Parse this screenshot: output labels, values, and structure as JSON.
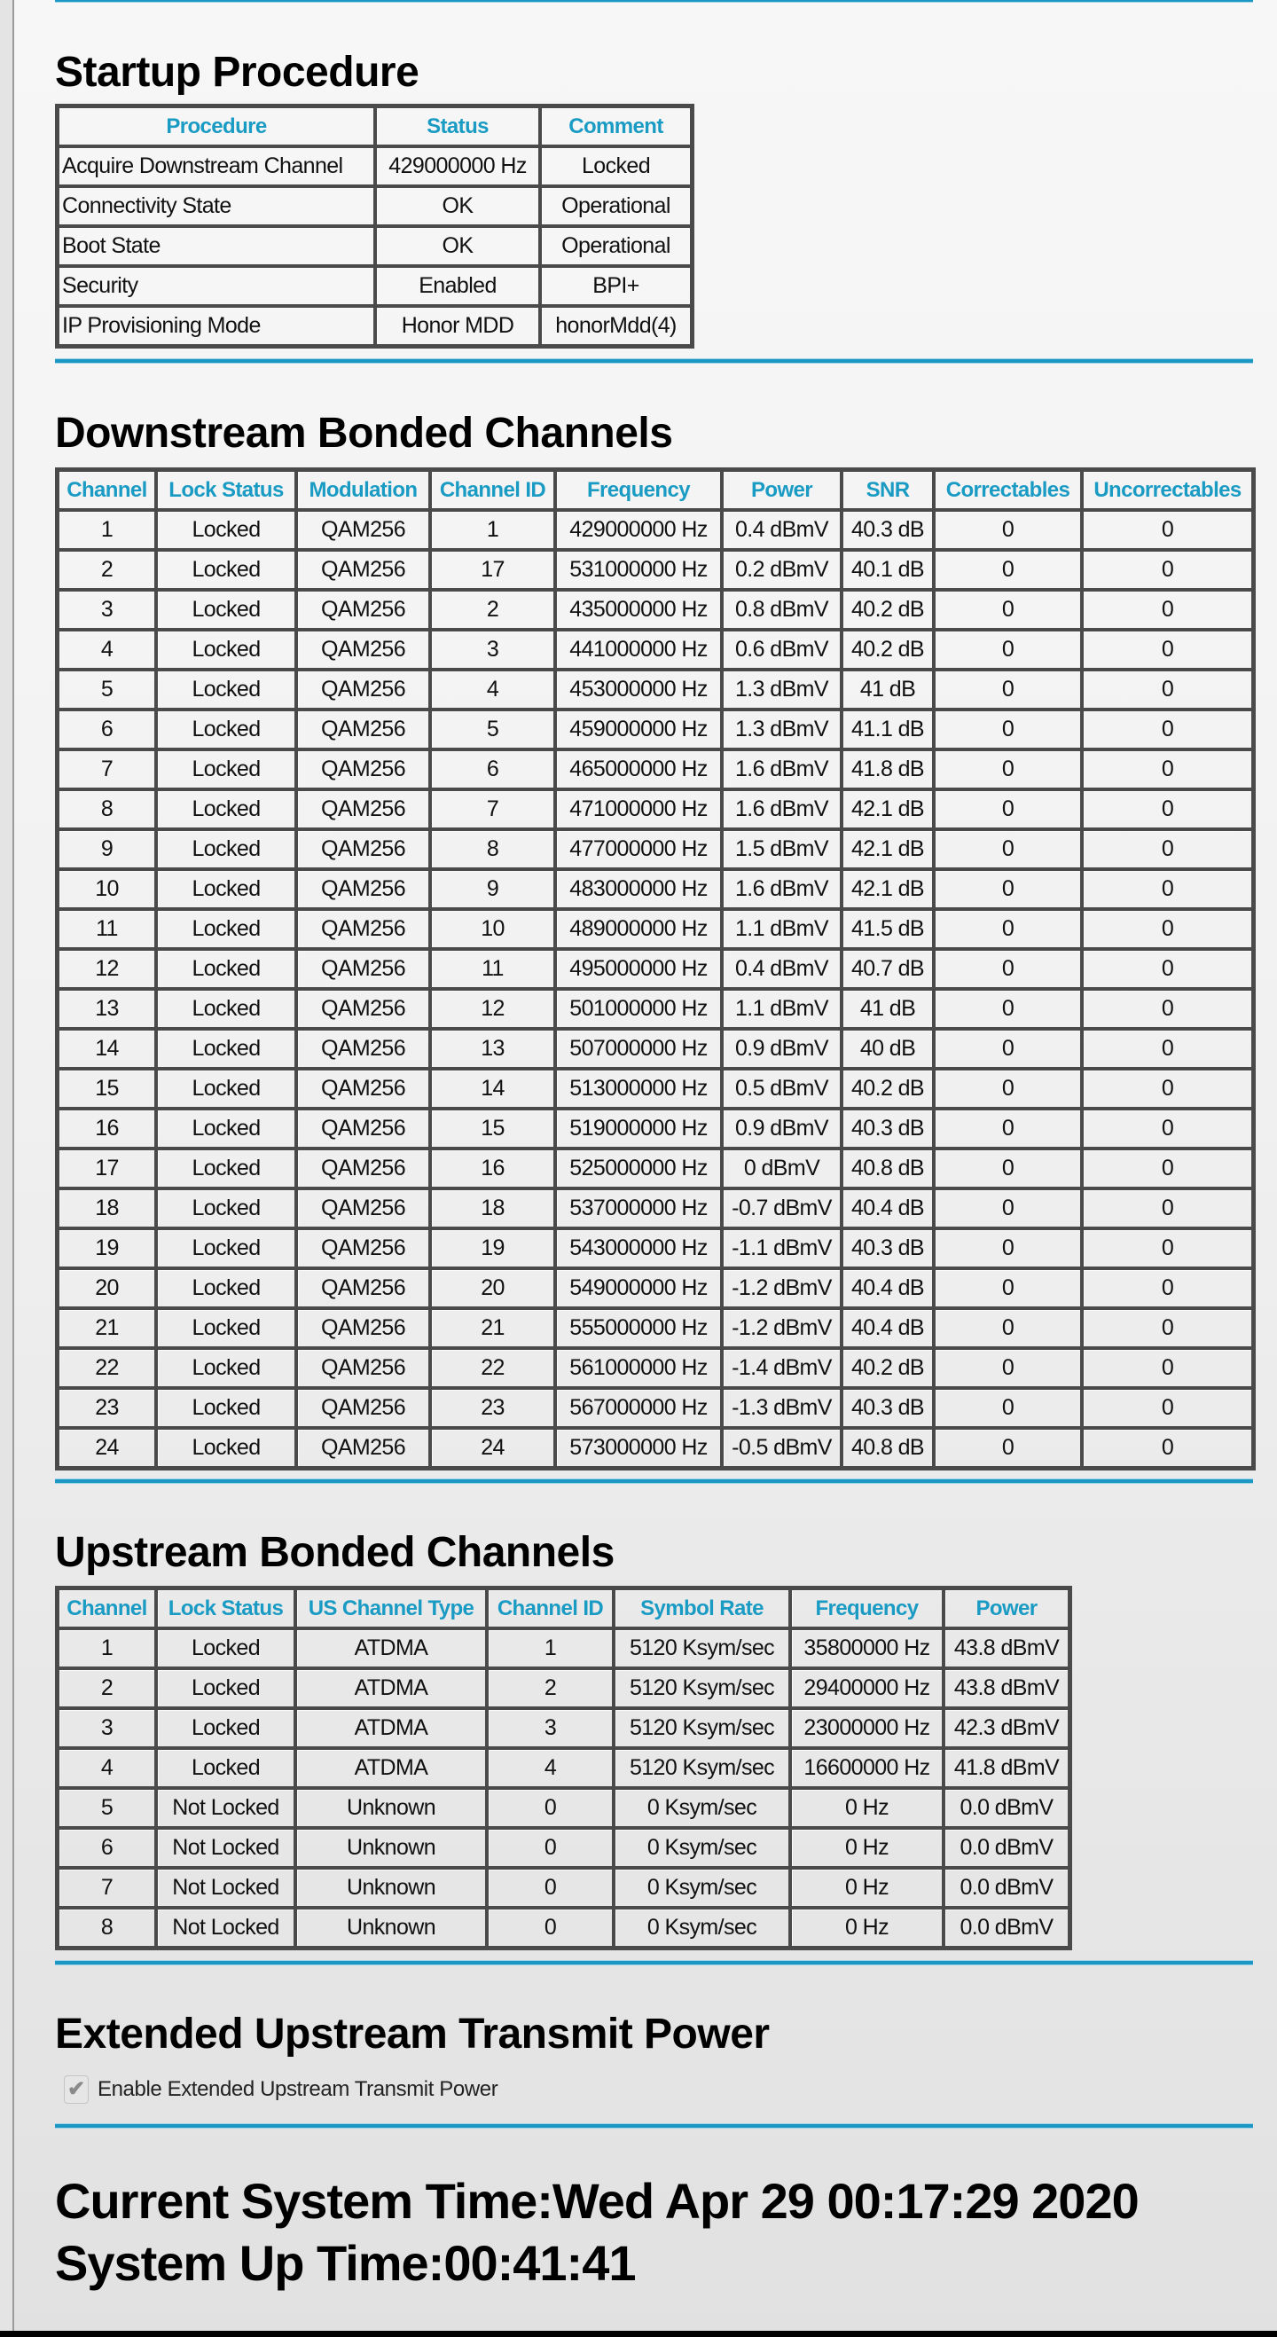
{
  "colors": {
    "accent": "#1a9bc4",
    "divider": "#1c97c4",
    "table_border": "#4a4a4a"
  },
  "startup": {
    "title": "Startup Procedure",
    "columns": [
      "Procedure",
      "Status",
      "Comment"
    ],
    "rows": [
      [
        "Acquire Downstream Channel",
        "429000000 Hz",
        "Locked"
      ],
      [
        "Connectivity State",
        "OK",
        "Operational"
      ],
      [
        "Boot State",
        "OK",
        "Operational"
      ],
      [
        "Security",
        "Enabled",
        "BPI+"
      ],
      [
        "IP Provisioning Mode",
        "Honor MDD",
        "honorMdd(4)"
      ]
    ]
  },
  "downstream": {
    "title": "Downstream Bonded Channels",
    "columns": [
      "Channel",
      "Lock Status",
      "Modulation",
      "Channel ID",
      "Frequency",
      "Power",
      "SNR",
      "Correctables",
      "Uncorrectables"
    ],
    "rows": [
      [
        "1",
        "Locked",
        "QAM256",
        "1",
        "429000000 Hz",
        "0.4 dBmV",
        "40.3 dB",
        "0",
        "0"
      ],
      [
        "2",
        "Locked",
        "QAM256",
        "17",
        "531000000 Hz",
        "0.2 dBmV",
        "40.1 dB",
        "0",
        "0"
      ],
      [
        "3",
        "Locked",
        "QAM256",
        "2",
        "435000000 Hz",
        "0.8 dBmV",
        "40.2 dB",
        "0",
        "0"
      ],
      [
        "4",
        "Locked",
        "QAM256",
        "3",
        "441000000 Hz",
        "0.6 dBmV",
        "40.2 dB",
        "0",
        "0"
      ],
      [
        "5",
        "Locked",
        "QAM256",
        "4",
        "453000000 Hz",
        "1.3 dBmV",
        "41 dB",
        "0",
        "0"
      ],
      [
        "6",
        "Locked",
        "QAM256",
        "5",
        "459000000 Hz",
        "1.3 dBmV",
        "41.1 dB",
        "0",
        "0"
      ],
      [
        "7",
        "Locked",
        "QAM256",
        "6",
        "465000000 Hz",
        "1.6 dBmV",
        "41.8 dB",
        "0",
        "0"
      ],
      [
        "8",
        "Locked",
        "QAM256",
        "7",
        "471000000 Hz",
        "1.6 dBmV",
        "42.1 dB",
        "0",
        "0"
      ],
      [
        "9",
        "Locked",
        "QAM256",
        "8",
        "477000000 Hz",
        "1.5 dBmV",
        "42.1 dB",
        "0",
        "0"
      ],
      [
        "10",
        "Locked",
        "QAM256",
        "9",
        "483000000 Hz",
        "1.6 dBmV",
        "42.1 dB",
        "0",
        "0"
      ],
      [
        "11",
        "Locked",
        "QAM256",
        "10",
        "489000000 Hz",
        "1.1 dBmV",
        "41.5 dB",
        "0",
        "0"
      ],
      [
        "12",
        "Locked",
        "QAM256",
        "11",
        "495000000 Hz",
        "0.4 dBmV",
        "40.7 dB",
        "0",
        "0"
      ],
      [
        "13",
        "Locked",
        "QAM256",
        "12",
        "501000000 Hz",
        "1.1 dBmV",
        "41 dB",
        "0",
        "0"
      ],
      [
        "14",
        "Locked",
        "QAM256",
        "13",
        "507000000 Hz",
        "0.9 dBmV",
        "40 dB",
        "0",
        "0"
      ],
      [
        "15",
        "Locked",
        "QAM256",
        "14",
        "513000000 Hz",
        "0.5 dBmV",
        "40.2 dB",
        "0",
        "0"
      ],
      [
        "16",
        "Locked",
        "QAM256",
        "15",
        "519000000 Hz",
        "0.9 dBmV",
        "40.3 dB",
        "0",
        "0"
      ],
      [
        "17",
        "Locked",
        "QAM256",
        "16",
        "525000000 Hz",
        "0 dBmV",
        "40.8 dB",
        "0",
        "0"
      ],
      [
        "18",
        "Locked",
        "QAM256",
        "18",
        "537000000 Hz",
        "-0.7 dBmV",
        "40.4 dB",
        "0",
        "0"
      ],
      [
        "19",
        "Locked",
        "QAM256",
        "19",
        "543000000 Hz",
        "-1.1 dBmV",
        "40.3 dB",
        "0",
        "0"
      ],
      [
        "20",
        "Locked",
        "QAM256",
        "20",
        "549000000 Hz",
        "-1.2 dBmV",
        "40.4 dB",
        "0",
        "0"
      ],
      [
        "21",
        "Locked",
        "QAM256",
        "21",
        "555000000 Hz",
        "-1.2 dBmV",
        "40.4 dB",
        "0",
        "0"
      ],
      [
        "22",
        "Locked",
        "QAM256",
        "22",
        "561000000 Hz",
        "-1.4 dBmV",
        "40.2 dB",
        "0",
        "0"
      ],
      [
        "23",
        "Locked",
        "QAM256",
        "23",
        "567000000 Hz",
        "-1.3 dBmV",
        "40.3 dB",
        "0",
        "0"
      ],
      [
        "24",
        "Locked",
        "QAM256",
        "24",
        "573000000 Hz",
        "-0.5 dBmV",
        "40.8 dB",
        "0",
        "0"
      ]
    ]
  },
  "upstream": {
    "title": "Upstream Bonded Channels",
    "columns": [
      "Channel",
      "Lock Status",
      "US Channel Type",
      "Channel ID",
      "Symbol Rate",
      "Frequency",
      "Power"
    ],
    "rows": [
      [
        "1",
        "Locked",
        "ATDMA",
        "1",
        "5120 Ksym/sec",
        "35800000 Hz",
        "43.8 dBmV"
      ],
      [
        "2",
        "Locked",
        "ATDMA",
        "2",
        "5120 Ksym/sec",
        "29400000 Hz",
        "43.8 dBmV"
      ],
      [
        "3",
        "Locked",
        "ATDMA",
        "3",
        "5120 Ksym/sec",
        "23000000 Hz",
        "42.3 dBmV"
      ],
      [
        "4",
        "Locked",
        "ATDMA",
        "4",
        "5120 Ksym/sec",
        "16600000 Hz",
        "41.8 dBmV"
      ],
      [
        "5",
        "Not Locked",
        "Unknown",
        "0",
        "0 Ksym/sec",
        "0 Hz",
        "0.0 dBmV"
      ],
      [
        "6",
        "Not Locked",
        "Unknown",
        "0",
        "0 Ksym/sec",
        "0 Hz",
        "0.0 dBmV"
      ],
      [
        "7",
        "Not Locked",
        "Unknown",
        "0",
        "0 Ksym/sec",
        "0 Hz",
        "0.0 dBmV"
      ],
      [
        "8",
        "Not Locked",
        "Unknown",
        "0",
        "0 Ksym/sec",
        "0 Hz",
        "0.0 dBmV"
      ]
    ]
  },
  "extended": {
    "title": "Extended Upstream Transmit Power",
    "checkbox_label": "Enable Extended Upstream Transmit Power",
    "checkbox_checked": true,
    "checkbox_disabled": true,
    "check_glyph": "✔"
  },
  "system": {
    "current_time": "Current System Time:Wed Apr 29 00:17:29 2020",
    "up_time": "System Up Time:00:41:41"
  }
}
